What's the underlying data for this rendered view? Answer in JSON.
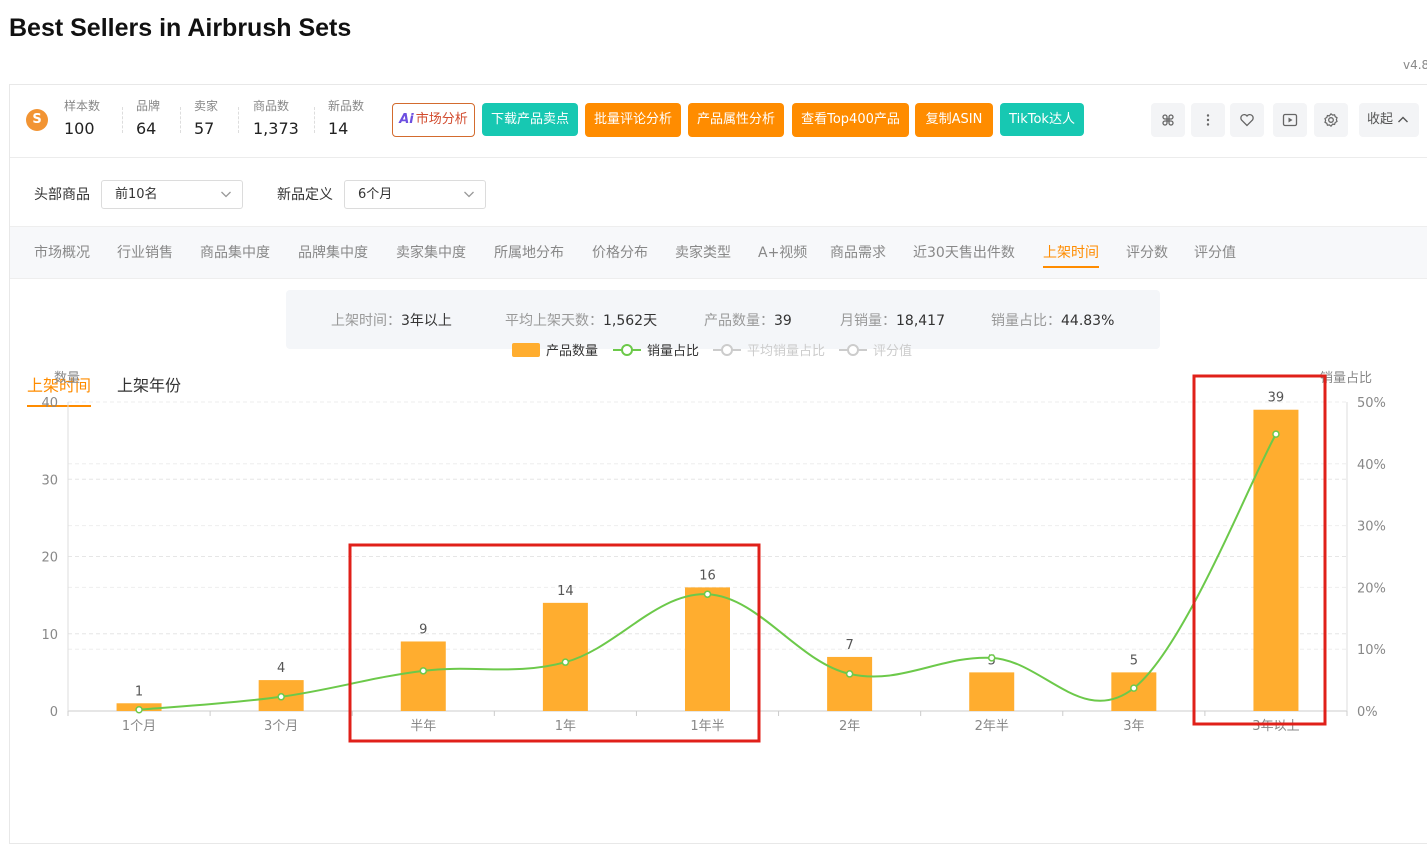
{
  "page": {
    "title": "Best Sellers in Airbrush Sets",
    "version": "v4.8."
  },
  "stats": [
    {
      "label": "样本数",
      "value": "100"
    },
    {
      "label": "品牌",
      "value": "64"
    },
    {
      "label": "卖家",
      "value": "57"
    },
    {
      "label": "商品数",
      "value": "1,373"
    },
    {
      "label": "新品数",
      "value": "14"
    }
  ],
  "actions": {
    "ai_label": "市场分析",
    "ai_mark": "Ai",
    "download_label": "下载产品卖点",
    "batch_review_label": "批量评论分析",
    "attr_label": "产品属性分析",
    "top400_label": "查看Top400产品",
    "copy_asin_label": "复制ASIN",
    "tiktok_label": "TikTok达人",
    "collapse_label": "收起"
  },
  "filters": {
    "head_label": "头部商品",
    "head_value": "前10名",
    "new_label": "新品定义",
    "new_value": "6个月"
  },
  "tabs": [
    "市场概况",
    "行业销售",
    "商品集中度",
    "品牌集中度",
    "卖家集中度",
    "所属地分布",
    "价格分布",
    "卖家类型",
    "A+视频",
    "商品需求",
    "近30天售出件数",
    "上架时间",
    "评分数",
    "评分值"
  ],
  "active_tab": "上架时间",
  "summary": [
    {
      "key": "上架时间：",
      "value": "3年以上"
    },
    {
      "key": "平均上架天数：",
      "value": "1,562天"
    },
    {
      "key": "产品数量：",
      "value": "39"
    },
    {
      "key": "月销量：",
      "value": "18,417"
    },
    {
      "key": "销量占比：",
      "value": "44.83%"
    }
  ],
  "subtabs": {
    "active": "上架时间",
    "other": "上架年份"
  },
  "colors": {
    "accent": "#ff8c00",
    "teal": "#17c8b2",
    "bar": "#ffad2f",
    "line": "#6cc94a",
    "highlight": "#e0201a"
  },
  "chart_data": {
    "type": "bar",
    "categories": [
      "1个月",
      "3个月",
      "半年",
      "1年",
      "1年半",
      "2年",
      "2年半",
      "3年",
      "3年以上"
    ],
    "series": [
      {
        "name": "产品数量",
        "type": "bar",
        "values": [
          1,
          4,
          9,
          14,
          16,
          7,
          5,
          5,
          39
        ]
      },
      {
        "name": "销量占比",
        "type": "line",
        "values": [
          0.2,
          2.3,
          6.5,
          7.9,
          18.9,
          6.0,
          8.6,
          3.7,
          44.8
        ]
      }
    ],
    "inactive_legend": [
      "平均销量占比",
      "评分值"
    ],
    "ylabel": "数量",
    "y2label": "销量占比",
    "ylim": [
      0,
      40
    ],
    "y2lim": [
      0,
      50
    ],
    "yticks": [
      "0",
      "10",
      "20",
      "30",
      "40"
    ],
    "y2ticks": [
      "0%",
      "10%",
      "20%",
      "30%",
      "40%",
      "50%"
    ],
    "data_labels": [
      "1",
      "4",
      "9",
      "14",
      "16",
      "7",
      "5",
      "5",
      "39"
    ],
    "grid": true,
    "legend_position": "top-center"
  }
}
